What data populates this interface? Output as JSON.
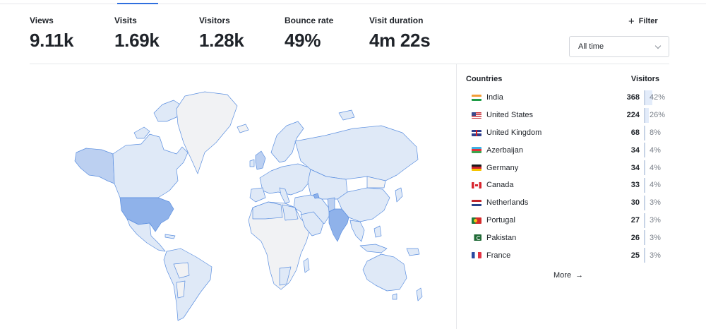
{
  "stats": [
    {
      "label": "Views",
      "value": "9.11k"
    },
    {
      "label": "Visits",
      "value": "1.69k"
    },
    {
      "label": "Visitors",
      "value": "1.28k"
    },
    {
      "label": "Bounce rate",
      "value": "49%"
    },
    {
      "label": "Visit duration",
      "value": "4m 22s"
    }
  ],
  "toolbar": {
    "filter_label": "Filter",
    "filter_icon": "plus-icon",
    "range_value": "All time"
  },
  "countries": {
    "heading": "Countries",
    "column_label": "Visitors",
    "rows": [
      {
        "name": "India",
        "flag": "flag-india-icon",
        "visitors": "368",
        "percent": "42%",
        "share": 0.42
      },
      {
        "name": "United States",
        "flag": "flag-united-states-icon",
        "visitors": "224",
        "percent": "26%",
        "share": 0.26
      },
      {
        "name": "United Kingdom",
        "flag": "flag-united-kingdom-icon",
        "visitors": "68",
        "percent": "8%",
        "share": 0.08
      },
      {
        "name": "Azerbaijan",
        "flag": "flag-azerbaijan-icon",
        "visitors": "34",
        "percent": "4%",
        "share": 0.04
      },
      {
        "name": "Germany",
        "flag": "flag-germany-icon",
        "visitors": "34",
        "percent": "4%",
        "share": 0.04
      },
      {
        "name": "Canada",
        "flag": "flag-canada-icon",
        "visitors": "33",
        "percent": "4%",
        "share": 0.04
      },
      {
        "name": "Netherlands",
        "flag": "flag-netherlands-icon",
        "visitors": "30",
        "percent": "3%",
        "share": 0.03
      },
      {
        "name": "Portugal",
        "flag": "flag-portugal-icon",
        "visitors": "27",
        "percent": "3%",
        "share": 0.03
      },
      {
        "name": "Pakistan",
        "flag": "flag-pakistan-icon",
        "visitors": "26",
        "percent": "3%",
        "share": 0.03
      },
      {
        "name": "France",
        "flag": "flag-france-icon",
        "visitors": "25",
        "percent": "3%",
        "share": 0.03
      }
    ],
    "more_label": "More",
    "more_icon": "arrow-right-icon"
  },
  "colors": {
    "accent": "#2f6fde",
    "map_land": "#dfe9f7",
    "map_high": "#8fb2ea",
    "map_mid": "#bcd0f1",
    "map_empty": "#f1f2f4",
    "map_border": "#5b8fe0",
    "bar_fill": "#e3ecfa"
  }
}
